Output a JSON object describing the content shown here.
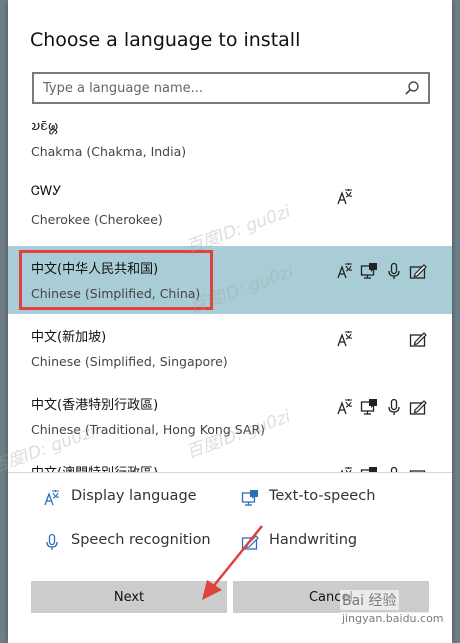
{
  "dialog": {
    "title": "Choose a language to install",
    "search": {
      "placeholder": "Type a language name...",
      "icon": "search-icon"
    }
  },
  "languages": [
    {
      "native": "𑄌𑄋𑄴𑄟𑄳𑄦",
      "english": "Chakma (Chakma, India)",
      "features": []
    },
    {
      "native": "ᏣᎳᎩ",
      "english": "Cherokee (Cherokee)",
      "features": [
        "display"
      ]
    },
    {
      "native": "中文(中华人民共和国)",
      "english": "Chinese (Simplified, China)",
      "features": [
        "display",
        "tts",
        "speech",
        "handwriting"
      ],
      "selected": true
    },
    {
      "native": "中文(新加坡)",
      "english": "Chinese (Simplified, Singapore)",
      "features": [
        "display",
        "handwriting"
      ]
    },
    {
      "native": "中文(香港特別行政區)",
      "english": "Chinese (Traditional, Hong Kong SAR)",
      "features": [
        "display",
        "tts",
        "speech",
        "handwriting"
      ]
    },
    {
      "native": "中文(澳門特別行政區)",
      "english": "",
      "features": [
        "display",
        "tts",
        "speech",
        "handwriting"
      ]
    }
  ],
  "legend": {
    "display": "Display language",
    "tts": "Text-to-speech",
    "speech": "Speech recognition",
    "handwriting": "Handwriting"
  },
  "buttons": {
    "next": "Next",
    "cancel": "Cancel"
  },
  "watermark": {
    "text": "百度ID: gu0zi",
    "brand": "Bai 经验",
    "url": "jingyan.baidu.com"
  },
  "colors": {
    "selected_bg": "#a9cdd6",
    "highlight_border": "#e0413c",
    "button_bg": "#cccccc",
    "accent_icon": "#2b6fb8"
  }
}
